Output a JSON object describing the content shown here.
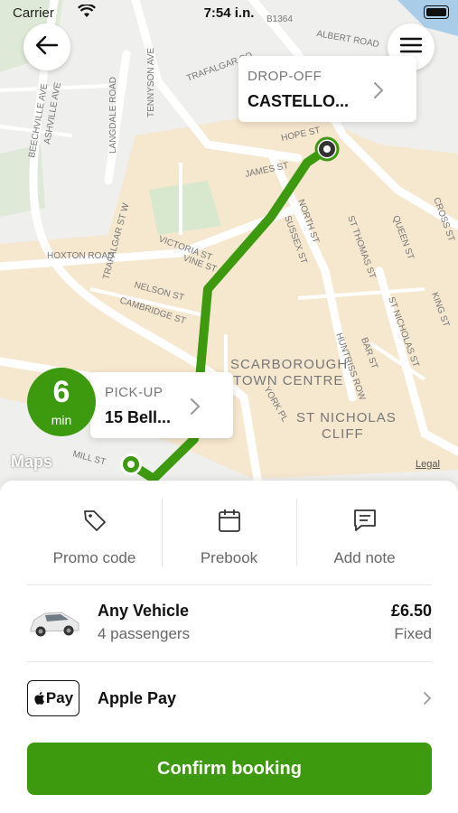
{
  "status_bar": {
    "carrier": "Carrier",
    "time": "7:54 i.n."
  },
  "map": {
    "street_labels": [
      "HOXTON ROAD",
      "VICTORIA ST",
      "NELSON ST",
      "CAMBRIDGE ST",
      "JAMES ST",
      "HOPE ST",
      "ALBERT ROAD",
      "NORTH ST",
      "SUSSEX ST",
      "ST THOMAS ST",
      "QUEEN ST",
      "ST NICHOLAS ST",
      "BAR ST",
      "HUNTRISS ROW",
      "YORK PL",
      "KING ST",
      "CROSS ST",
      "TRAFALGAR SQ",
      "TRAFALGAR ST W",
      "LANGDALE ROAD",
      "TENNYSON AVE",
      "BEECHVILLE AVE",
      "ASHVILLE AVE",
      "VINE ST",
      "MILL ST",
      "B1364"
    ],
    "area_labels": [
      "SCARBOROUGH",
      "TOWN CENTRE",
      "ST NICHOLAS",
      "CLIFF"
    ],
    "maps_logo": "Maps",
    "legal": "Legal"
  },
  "dropoff": {
    "label": "DROP-OFF",
    "value": "CASTELLO..."
  },
  "pickup": {
    "label": "PICK-UP",
    "value": "15 Bell...",
    "eta_value": "6",
    "eta_unit": "min"
  },
  "actions": [
    {
      "label": "Promo code",
      "icon": "tag-icon"
    },
    {
      "label": "Prebook",
      "icon": "calendar-icon"
    },
    {
      "label": "Add note",
      "icon": "note-icon"
    }
  ],
  "vehicle": {
    "name": "Any Vehicle",
    "passengers": "4 passengers",
    "price": "£6.50",
    "price_type": "Fixed",
    "icon": "car-icon"
  },
  "payment": {
    "badge": "Pay",
    "name": "Apple Pay"
  },
  "confirm_label": "Confirm booking",
  "colors": {
    "accent": "#3d9a0f",
    "route": "#3d9a0f"
  }
}
